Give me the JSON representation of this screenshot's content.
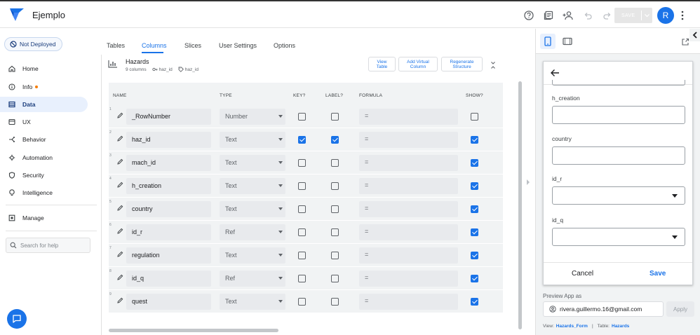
{
  "app": {
    "name": "Ejemplo"
  },
  "colors": {
    "accent": "#1a73e8",
    "info_dot": "#f57c00"
  },
  "topbar": {
    "save_label": "SAVE",
    "avatar_initial": "R"
  },
  "sidebar": {
    "deploy_status": "Not Deployed",
    "items": [
      {
        "label": "Home",
        "icon": "home-icon"
      },
      {
        "label": "Info",
        "icon": "info-icon"
      },
      {
        "label": "Data",
        "icon": "data-icon"
      },
      {
        "label": "UX",
        "icon": "ux-icon"
      },
      {
        "label": "Behavior",
        "icon": "behavior-icon"
      },
      {
        "label": "Automation",
        "icon": "automation-icon"
      },
      {
        "label": "Security",
        "icon": "shield-icon"
      },
      {
        "label": "Intelligence",
        "icon": "bulb-icon"
      },
      {
        "label": "Manage",
        "icon": "manage-icon"
      }
    ],
    "help_placeholder": "Search for help"
  },
  "tabs": [
    "Tables",
    "Columns",
    "Slices",
    "User Settings",
    "Options"
  ],
  "table": {
    "name": "Hazards",
    "columns_count": "9 columns",
    "key_chip": "haz_id",
    "label_chip": "haz_id",
    "btn_view": "View Table",
    "btn_add_virtual": "Add Virtual Column",
    "btn_regenerate": "Regenerate Structure",
    "headers": {
      "name": "NAME",
      "type": "TYPE",
      "key": "KEY?",
      "label": "LABEL?",
      "formula": "FORMULA",
      "show": "SHOW?"
    },
    "rows": [
      {
        "num": "1",
        "name": "_RowNumber",
        "type": "Number",
        "formula": "=",
        "key": false,
        "label": false,
        "show": false
      },
      {
        "num": "2",
        "name": "haz_id",
        "type": "Text",
        "formula": "=",
        "key": true,
        "label": true,
        "show": true
      },
      {
        "num": "3",
        "name": "mach_id",
        "type": "Text",
        "formula": "=",
        "key": false,
        "label": false,
        "show": true
      },
      {
        "num": "4",
        "name": "h_creation",
        "type": "Text",
        "formula": "=",
        "key": false,
        "label": false,
        "show": true
      },
      {
        "num": "5",
        "name": "country",
        "type": "Text",
        "formula": "=",
        "key": false,
        "label": false,
        "show": true
      },
      {
        "num": "6",
        "name": "id_r",
        "type": "Ref",
        "formula": "=",
        "key": false,
        "label": false,
        "show": true
      },
      {
        "num": "7",
        "name": "regulation",
        "type": "Text",
        "formula": "=",
        "key": false,
        "label": false,
        "show": true
      },
      {
        "num": "8",
        "name": "id_q",
        "type": "Ref",
        "formula": "=",
        "key": false,
        "label": false,
        "show": true
      },
      {
        "num": "9",
        "name": "quest",
        "type": "Text",
        "formula": "=",
        "key": false,
        "label": false,
        "show": true
      }
    ]
  },
  "preview": {
    "form_fields": [
      {
        "label": "h_creation",
        "kind": "text"
      },
      {
        "label": "country",
        "kind": "text"
      },
      {
        "label": "id_r",
        "kind": "select"
      },
      {
        "label": "id_q",
        "kind": "select"
      }
    ],
    "cancel_label": "Cancel",
    "save_label": "Save",
    "preview_as_label": "Preview App as",
    "email": "rivera.guillermo.16@gmail.com",
    "apply_label": "Apply",
    "view_label": "View:",
    "view_value": "Hazards_Form",
    "table_label": "Table:",
    "table_value": "Hazards"
  }
}
